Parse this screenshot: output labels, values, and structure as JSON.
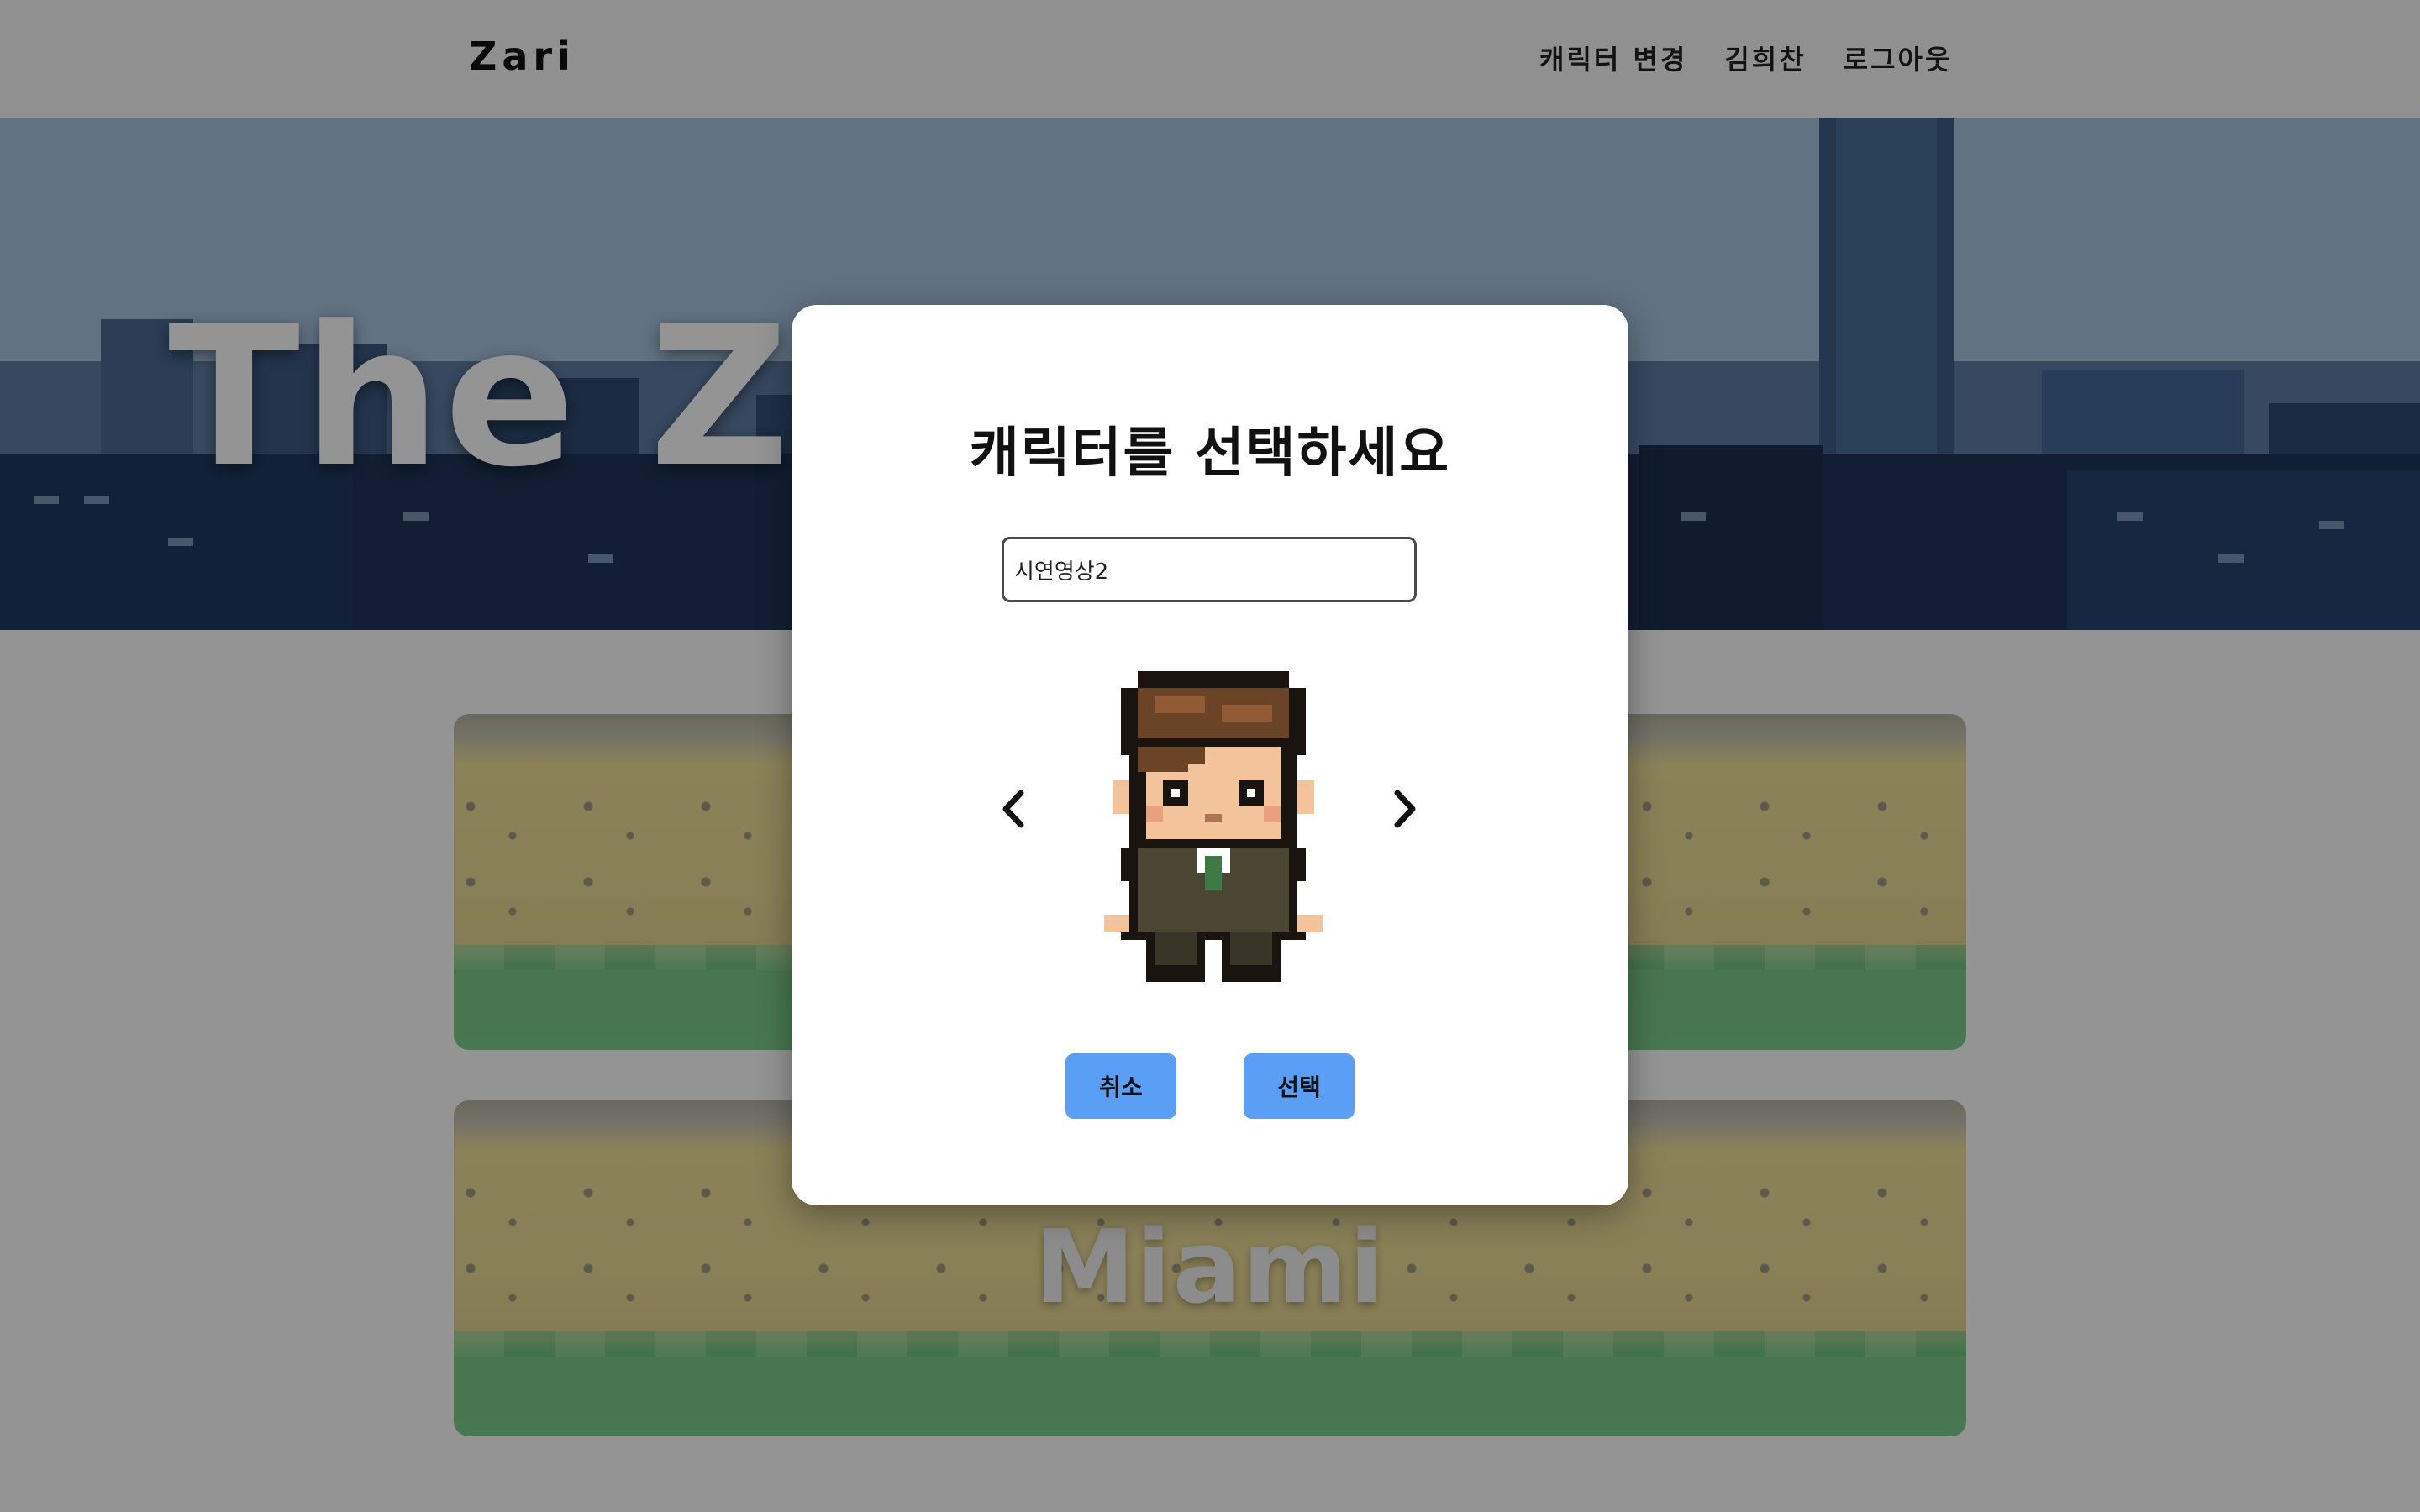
{
  "navbar": {
    "brand": "Zari",
    "links": [
      "캐릭터 변경",
      "김희찬",
      "로그아웃"
    ]
  },
  "hero": {
    "title": "The Zari"
  },
  "maps": [
    {
      "title": ""
    },
    {
      "title": "Miami"
    }
  ],
  "modal": {
    "title": "캐릭터를 선택하세요",
    "name_input_value": "시연영상2",
    "cancel_label": "취소",
    "select_label": "선택"
  },
  "icons": {
    "prev": "chevron-left-icon",
    "next": "chevron-right-icon"
  },
  "colors": {
    "button": "#5b9ef5",
    "overlay": "rgba(0,0,0,0.42)"
  }
}
